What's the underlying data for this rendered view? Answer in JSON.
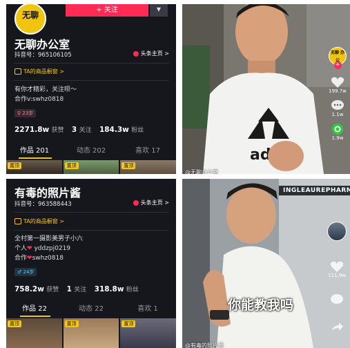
{
  "profile1": {
    "follow_label": "+ 关注",
    "dropdown_label": "▼",
    "logo_text": "无聊",
    "name": "无聊办公室",
    "id_line": "抖音号：965106105",
    "toutiao_label": "头条主页 >",
    "shop_label": "TA的商品橱窗 >",
    "bio_lines": [
      "有你才精彩，关注呗～",
      "合作v:swhz0818"
    ],
    "age": "23岁",
    "likes": "2271.8w",
    "likes_label": "获赞",
    "following": "3",
    "following_label": "关注",
    "fans": "184.3w",
    "fans_label": "粉丝",
    "tabs": [
      "作品 201",
      "动态 202",
      "喜欢 17"
    ],
    "pin_label": "置顶"
  },
  "profile2": {
    "name": "有毒的照片酱",
    "id_line": "抖音号：963588443",
    "toutiao_label": "头条主页 >",
    "shop_label": "TA的商品橱窗 >",
    "bio_line1": "全村第一摄影美男子小六",
    "bio_line2_pre": "个人",
    "bio_line2_post": "yddzpj0219",
    "bio_line3_pre": "合作",
    "bio_line3_post": "swhz0818",
    "heart_glyph": "❤",
    "age": "24岁",
    "likes": "758.2w",
    "likes_label": "获赞",
    "following": "1",
    "following_label": "关注",
    "fans": "318.8w",
    "fans_label": "粉丝",
    "tabs": [
      "作品 22",
      "动态 22",
      "喜欢 1"
    ],
    "pin_label": "置顶"
  },
  "video1": {
    "avatar_text": "无聊\n办公",
    "like_count": "199.7w",
    "comment_count": "1.1w",
    "share_count": "1.9w",
    "author": "@无聊办公室"
  },
  "video2": {
    "like_count": "111.9w",
    "comment_count": "",
    "share_count": "",
    "author": "@有毒的照片酱",
    "caption": "你能教我吗",
    "sign_text": "INGLEAUREPHARM"
  },
  "colors": {
    "accent_red": "#fe2c55",
    "accent_yellow": "#f5c518",
    "dark_bg": "#16161d",
    "share_green": "#2ecc40"
  }
}
